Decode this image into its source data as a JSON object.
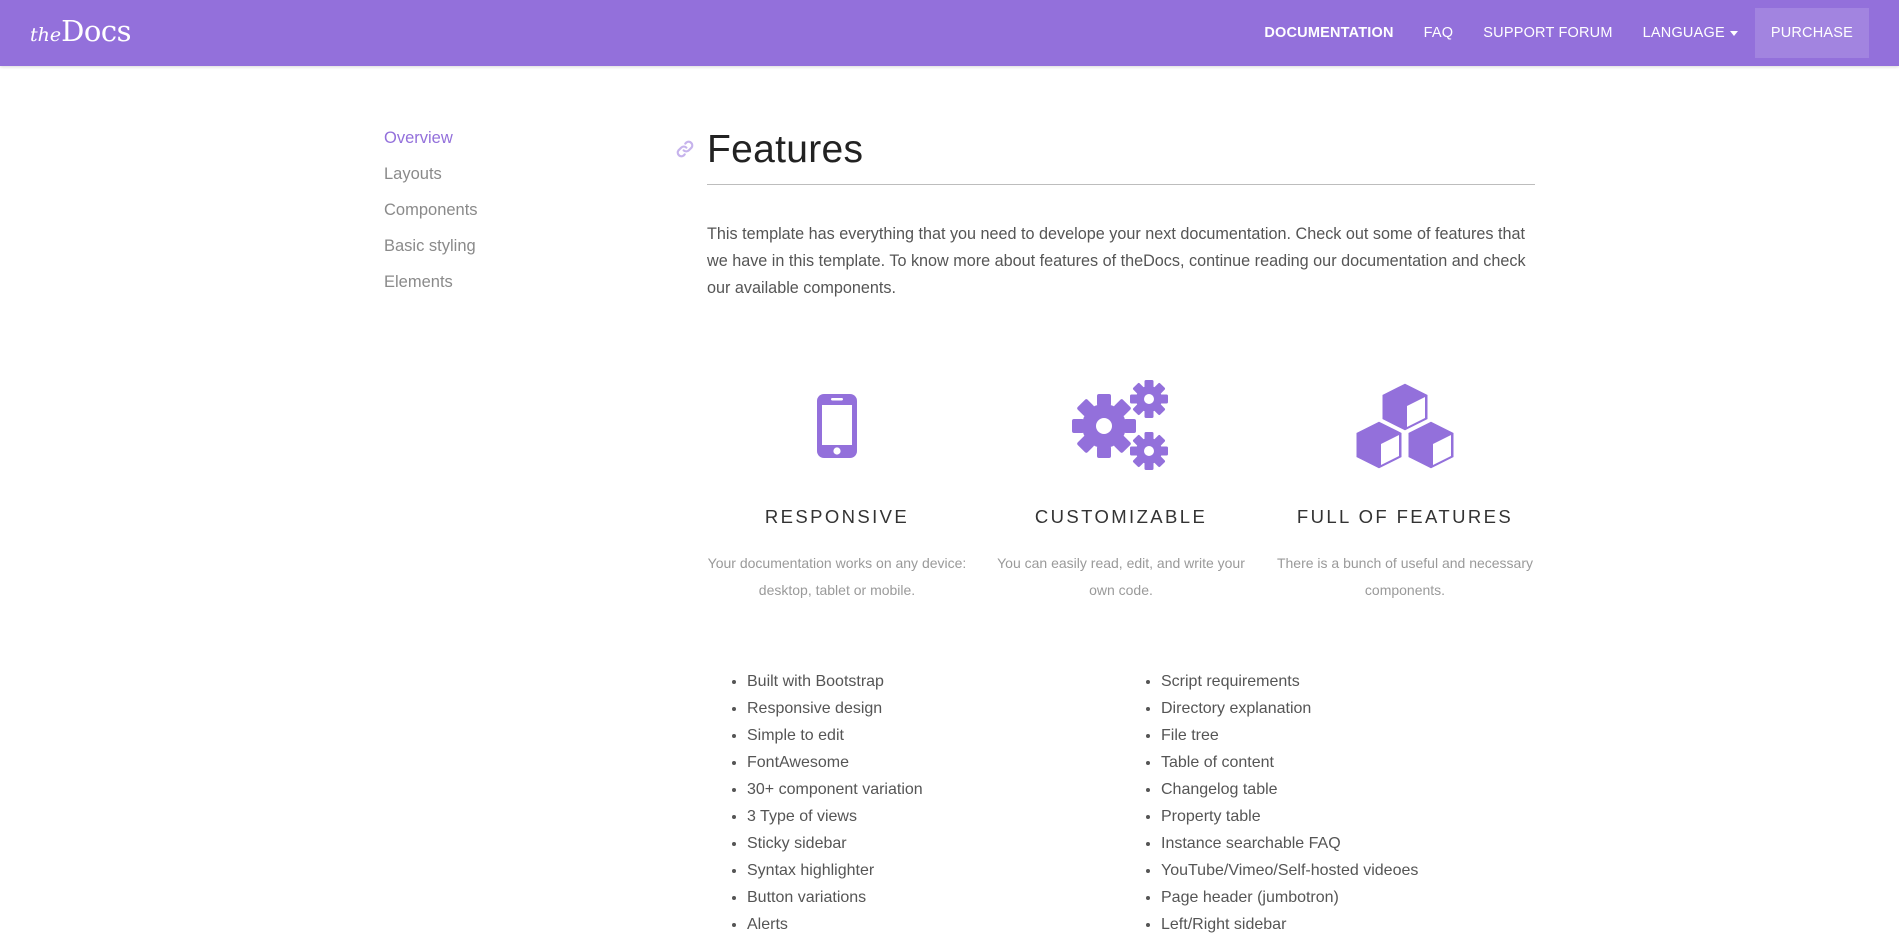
{
  "brand": {
    "the": "the",
    "docs": "Docs"
  },
  "nav": {
    "items": [
      "DOCUMENTATION",
      "FAQ",
      "SUPPORT FORUM",
      "LANGUAGE",
      "PURCHASE"
    ]
  },
  "sidebar": {
    "items": [
      "Overview",
      "Layouts",
      "Components",
      "Basic styling",
      "Elements"
    ],
    "active_index": 0
  },
  "main": {
    "title": "Features",
    "intro": "This template has everything that you need to develope your next documentation. Check out some of features that we have in this template. To know more about features of theDocs, continue reading our documentation and check our available components.",
    "features": [
      {
        "icon": "mobile-phone-icon",
        "title": "RESPONSIVE",
        "desc": "Your documentation works on any device: desktop, tablet or mobile."
      },
      {
        "icon": "gears-icon",
        "title": "CUSTOMIZABLE",
        "desc": "You can easily read, edit, and write your own code."
      },
      {
        "icon": "cubes-icon",
        "title": "FULL OF FEATURES",
        "desc": "There is a bunch of useful and necessary components."
      }
    ],
    "list_left": [
      "Built with Bootstrap",
      "Responsive design",
      "Simple to edit",
      "FontAwesome",
      "30+ component variation",
      "3 Type of views",
      "Sticky sidebar",
      "Syntax highlighter",
      "Button variations",
      "Alerts"
    ],
    "list_right": [
      "Script requirements",
      "Directory explanation",
      "File tree",
      "Table of content",
      "Changelog table",
      "Property table",
      "Instance searchable FAQ",
      "YouTube/Vimeo/Self-hosted videoes",
      "Page header (jumbotron)",
      "Left/Right sidebar"
    ]
  },
  "colors": {
    "accent": "#9370DB",
    "nav_bg": "#9370DB",
    "text": "#555555",
    "muted": "#9a9a9a"
  }
}
